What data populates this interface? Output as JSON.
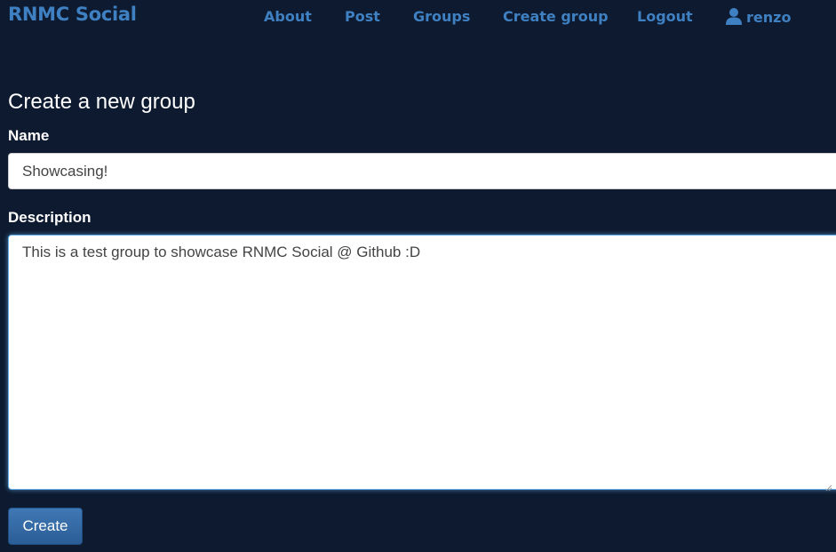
{
  "navbar": {
    "brand": "RNMC Social",
    "links": {
      "about": "About",
      "post": "Post",
      "groups": "Groups",
      "create_group": "Create group",
      "logout": "Logout"
    },
    "user": {
      "icon": "user-icon",
      "name": "renzo"
    }
  },
  "form": {
    "title": "Create a new group",
    "name_label": "Name",
    "name_value": "Showcasing!",
    "description_label": "Description",
    "description_value": "This is a test group to showcase RNMC Social @ Github :D",
    "submit_label": "Create"
  },
  "colors": {
    "background": "#0d1a2f",
    "brand": "#3f80c2",
    "button": "#2f67a4"
  }
}
